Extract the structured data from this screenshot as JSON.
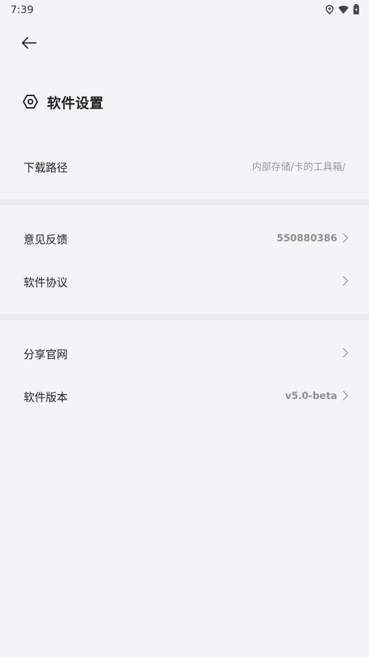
{
  "status_bar": {
    "time": "7:39"
  },
  "page": {
    "title": "软件设置"
  },
  "settings": {
    "download_path": {
      "label": "下载路径",
      "value": "内部存储/卡的工具箱/"
    },
    "feedback": {
      "label": "意见反馈",
      "value": "550880386"
    },
    "agreement": {
      "label": "软件协议"
    },
    "share": {
      "label": "分享官网"
    },
    "version": {
      "label": "软件版本",
      "value": "v5.0-beta"
    }
  },
  "icons": {
    "back": "arrow-left-icon",
    "title": "hexagon-gear-icon",
    "chevron": "chevron-right-icon",
    "location": "location-icon",
    "wifi": "wifi-icon",
    "battery": "battery-icon"
  },
  "colors": {
    "background": "#f4f4f6",
    "divider": "#ebebee",
    "text": "#222222",
    "secondary": "#9a9a9a"
  }
}
